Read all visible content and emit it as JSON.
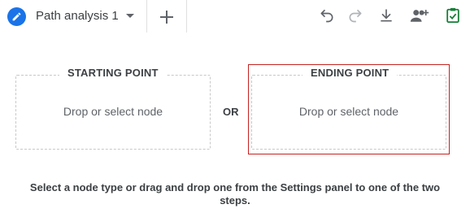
{
  "tabs": [
    {
      "label": "Path analysis 1",
      "active": true
    }
  ],
  "toolbar": {
    "icons": [
      "undo-icon",
      "redo-icon",
      "download-icon",
      "share-icon",
      "save-check-icon"
    ]
  },
  "starting_point": {
    "title": "STARTING POINT",
    "placeholder": "Drop or select node"
  },
  "connector": "OR",
  "ending_point": {
    "title": "ENDING POINT",
    "placeholder": "Drop or select node",
    "selected": true
  },
  "instructions": "Select a node type or drag and drop one from the Settings panel to one of the two steps.",
  "colors": {
    "accent": "#1a73e8",
    "selected_outline": "#c5221f",
    "save_green": "#188038",
    "dashed_border": "#c8c8c8"
  }
}
